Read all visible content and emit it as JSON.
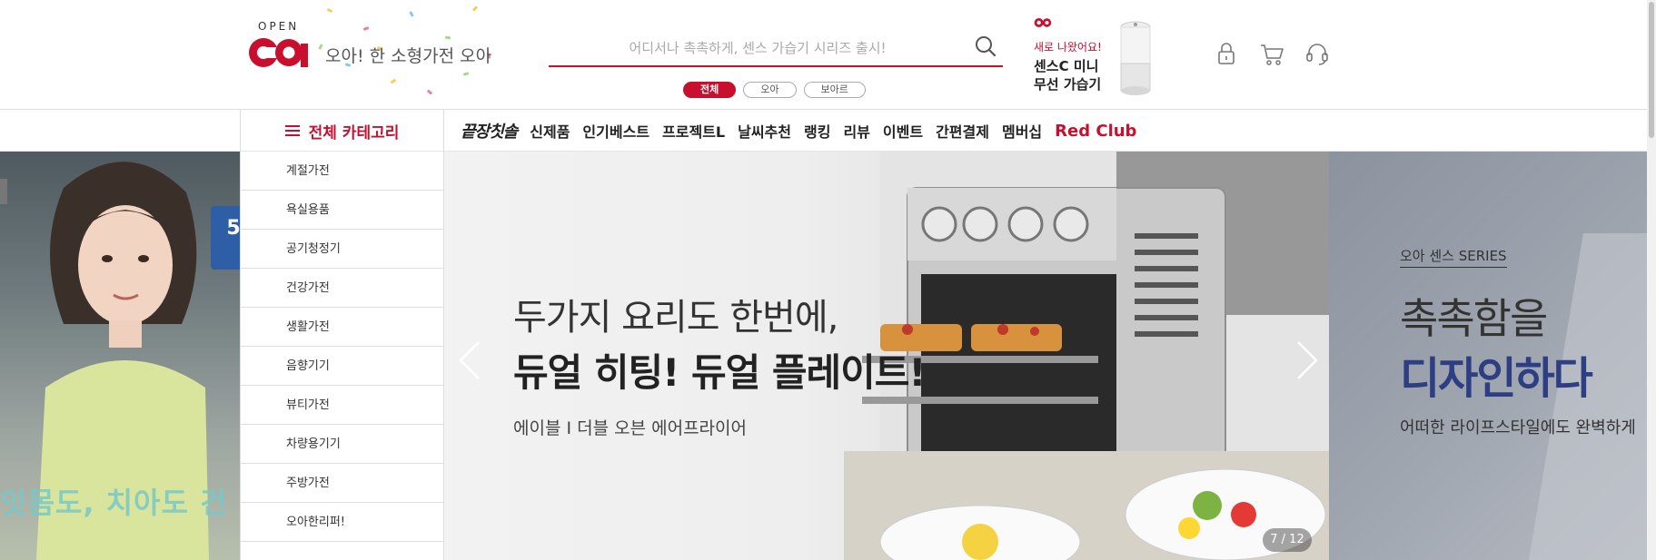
{
  "header": {
    "logo_open": "OPEN",
    "tagline": "오아! 한 소형가전 오아",
    "search": {
      "placeholder": "어디서나 촉촉하게, 센스 가습기 시리즈 출시!",
      "tabs": [
        "전체",
        "오아",
        "보아르"
      ]
    },
    "promo": {
      "new_label": "새로 나왔어요!",
      "name_line1": "센스C 미니",
      "name_line2": "무선 가습기"
    },
    "icons": [
      "lock-icon",
      "cart-icon",
      "headset-icon"
    ]
  },
  "nav": {
    "all_category": "전체 카테고리",
    "items": [
      "끝장칫솔",
      "신제품",
      "인기베스트",
      "프로젝트L",
      "날씨추천",
      "랭킹",
      "리뷰",
      "이벤트",
      "간편결제",
      "멤버십",
      "Red Club"
    ]
  },
  "categories": [
    "계절가전",
    "욕실용품",
    "공기청정기",
    "건강가전",
    "생활가전",
    "음향기기",
    "뷰티가전",
    "차량용기기",
    "주방가전",
    "오아한리퍼!"
  ],
  "hero": {
    "left": {
      "caption": "잇몸도, 치아도 건",
      "badge": "5"
    },
    "slide": {
      "line1": "두가지 요리도 한번에,",
      "line2": "듀얼 히팅! 듀얼 플레이트!",
      "line3": "에이블 I 더블 오븐 에어프라이어",
      "pager": "7 / 12"
    },
    "right": {
      "series": "오아 센스 SERIES",
      "heading1": "촉촉함을",
      "heading2": "디자인하다",
      "sub": "어떠한 라이프스타일에도 완벽하게"
    }
  },
  "colors": {
    "brand_red": "#c8102e",
    "accent_navy": "#2d3f82"
  }
}
